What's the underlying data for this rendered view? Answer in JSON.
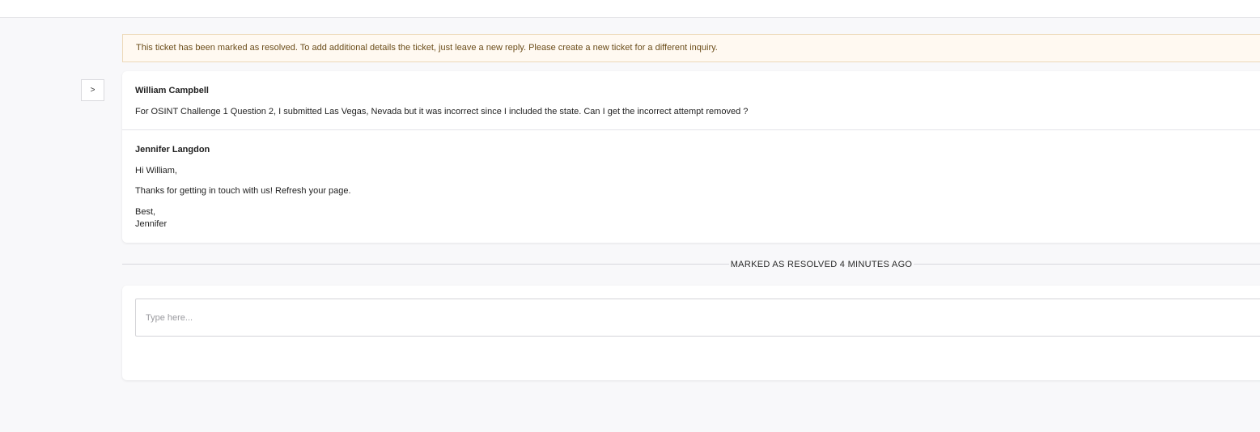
{
  "sidebar_toggle": {
    "label": ">"
  },
  "notice": {
    "text": "This ticket has been marked as resolved. To add additional details the ticket, just leave a new reply. Please create a new ticket for a different inquiry."
  },
  "messages": [
    {
      "author": "William Campbell",
      "lines": [
        "For OSINT Challenge 1 Question 2, I submitted Las Vegas, Nevada but it was incorrect since I included the state. Can I get the incorrect attempt removed ?"
      ]
    },
    {
      "author": "Jennifer Langdon",
      "lines": [
        "Hi William,",
        "Thanks for getting in touch with us! Refresh your page.",
        "Best,",
        "Jennifer"
      ]
    }
  ],
  "status_divider": {
    "label": "MARKED AS RESOLVED 4 MINUTES AGO"
  },
  "reply": {
    "placeholder": "Type here..."
  },
  "colors": {
    "notice_bg": "#fff9f1",
    "notice_border": "#ecd9b9",
    "notice_text": "#6b4d1a",
    "page_bg": "#f8f8fa"
  }
}
